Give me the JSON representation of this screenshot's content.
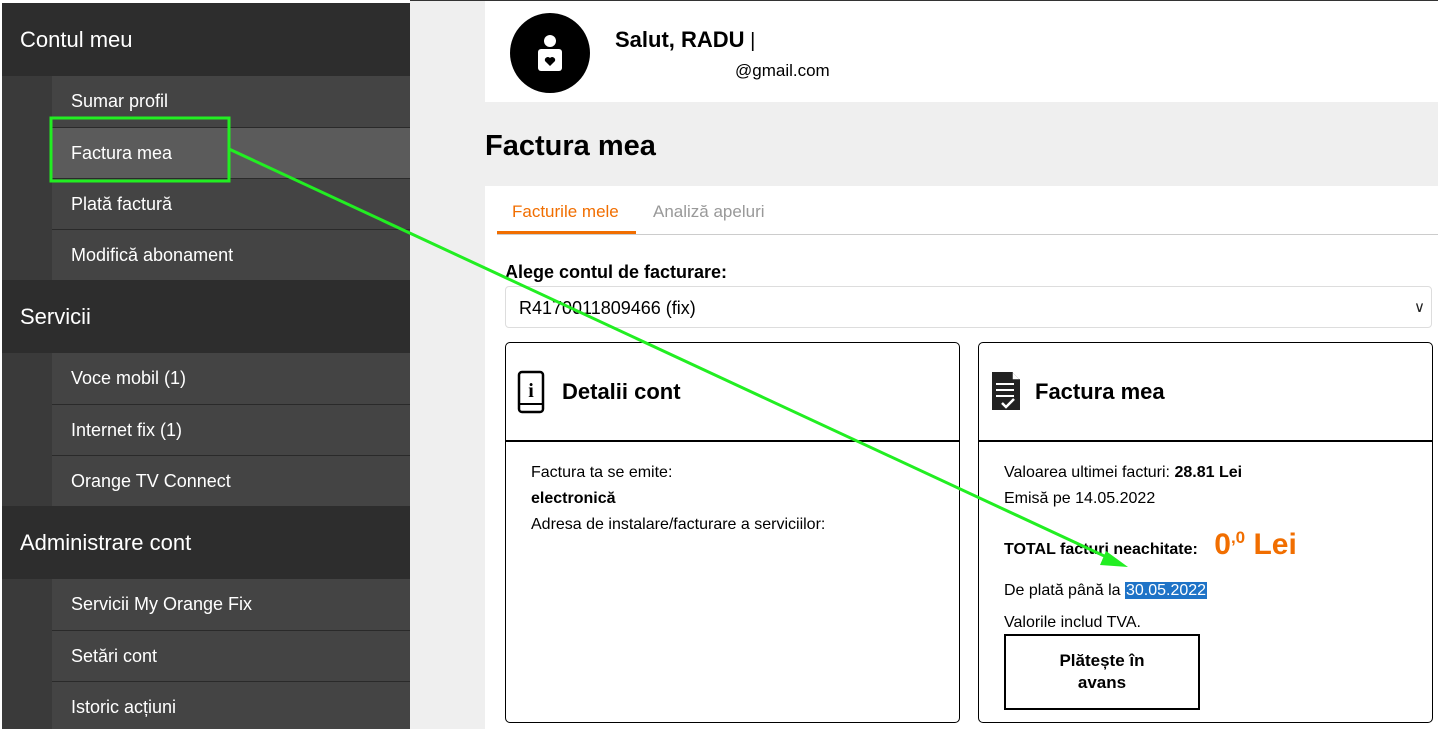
{
  "sidebar": {
    "sections": [
      {
        "title": "Contul meu",
        "items": [
          "Sumar profil",
          "Factura mea",
          "Plată factură",
          "Modifică abonament"
        ]
      },
      {
        "title": "Servicii",
        "items": [
          "Voce mobil (1)",
          "Internet fix (1)",
          "Orange TV Connect"
        ]
      },
      {
        "title": "Administrare cont",
        "items": [
          "Servicii My Orange Fix",
          "Setări cont",
          "Istoric acțiuni"
        ]
      }
    ],
    "active_item": "Factura mea"
  },
  "profile": {
    "greeting": "Salut, RADU",
    "email": "@gmail.com"
  },
  "page": {
    "title": "Factura mea"
  },
  "tabs": [
    "Facturile mele",
    "Analiză apeluri"
  ],
  "account": {
    "label": "Alege contul de facturare:",
    "selected": "R4170011809466 (fix)"
  },
  "details_card": {
    "title": "Detalii cont",
    "line1": "Factura ta se emite:",
    "line2": "electronică",
    "line3": "Adresa de instalare/facturare a serviciilor:"
  },
  "invoice_card": {
    "title": "Factura mea",
    "last_label": "Valoarea ultimei facturi:",
    "last_value": "28.81 Lei",
    "issued": "Emisă pe 14.05.2022",
    "total_label": "TOTAL facturi neachitate:",
    "total_int": "0",
    "total_dec": ",0",
    "total_unit": "Lei",
    "due_label": "De plată până la",
    "due_date": "30.05.2022",
    "vat_note": "Valorile includ TVA.",
    "pay_button_line1": "Plătește în",
    "pay_button_line2": "avans"
  },
  "colors": {
    "accent": "#f16e00",
    "annotation": "#22ee22",
    "selection": "#1e73c7"
  }
}
